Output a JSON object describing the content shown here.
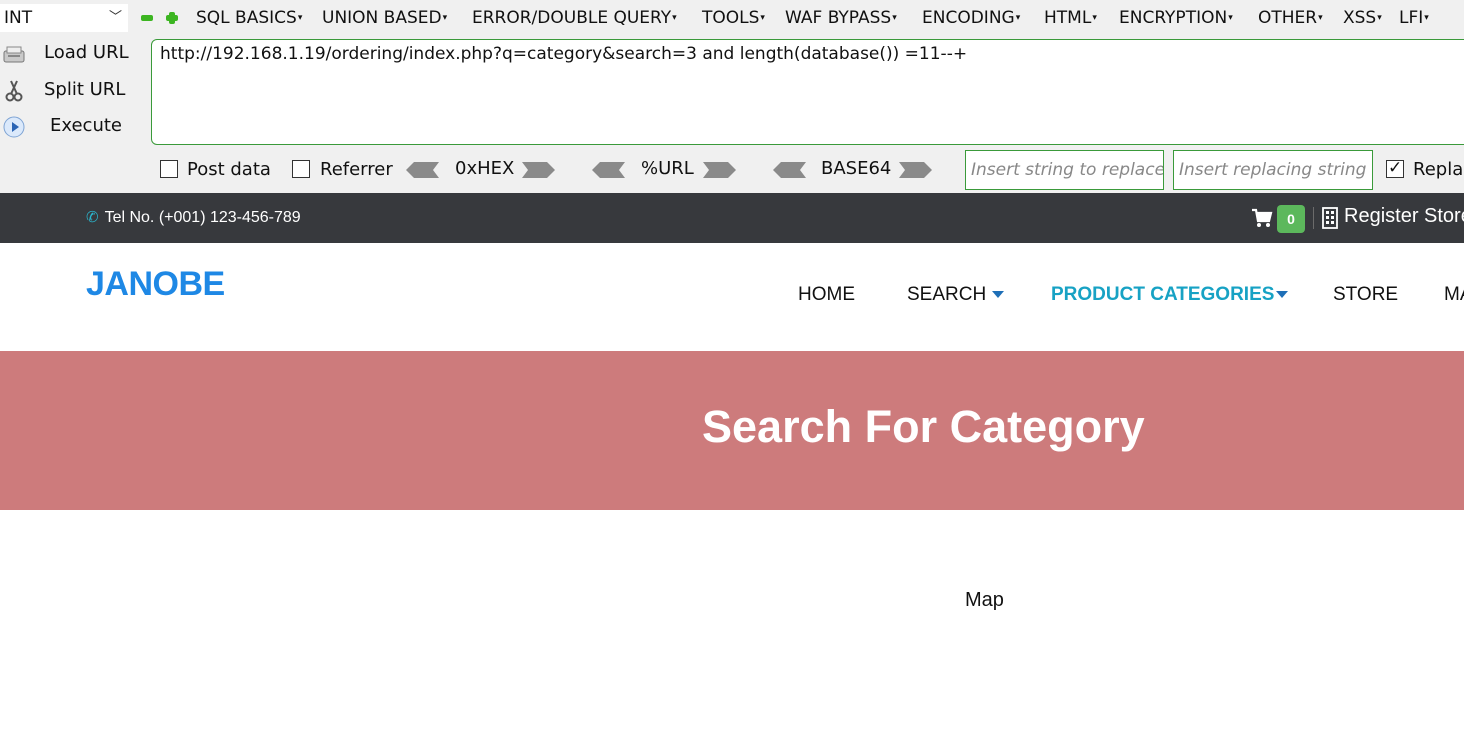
{
  "hackbar": {
    "type_select": "INT",
    "menu": [
      "SQL BASICS",
      "UNION BASED",
      "ERROR/DOUBLE QUERY",
      "TOOLS",
      "WAF BYPASS",
      "ENCODING",
      "HTML",
      "ENCRYPTION",
      "OTHER",
      "XSS",
      "LFI"
    ],
    "side_buttons": {
      "load": "Load URL",
      "split": "Split URL",
      "execute": "Execute"
    },
    "url": "http://192.168.1.19/ordering/index.php?q=category&search=3 and length(database()) =11--+",
    "options": {
      "post_data": "Post data",
      "referrer": "Referrer",
      "hex": "0xHEX",
      "url_enc": "%URL",
      "base64": "BASE64",
      "replace_placeholder": "Insert string to replace",
      "replacing_placeholder": "Insert replacing string",
      "replace_all": "Replace All"
    }
  },
  "topbar": {
    "tel": "Tel No. (+001) 123-456-789",
    "cart_count": "0",
    "register": "Register Store"
  },
  "navbar": {
    "logo": "JANOBE",
    "items": [
      "HOME",
      "SEARCH",
      "PRODUCT CATEGORIES",
      "STORE",
      "MAP"
    ]
  },
  "banner": {
    "title": "Search For Category"
  },
  "content": {
    "map_label": "Map"
  },
  "colors": {
    "topbar": "#37393d",
    "banner": "#cd7b7c",
    "logo": "#1e88e5",
    "active_nav": "#17a2c4",
    "badge": "#5cb85c"
  }
}
